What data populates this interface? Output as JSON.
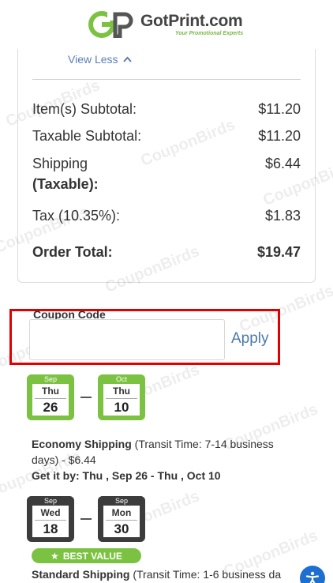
{
  "header": {
    "brand_name": "GotPrint.com",
    "tagline": "Your Promotional Experts"
  },
  "summary": {
    "view_less_label": "View Less",
    "rows": [
      {
        "label": "Item(s) Subtotal:",
        "value": "$11.20"
      },
      {
        "label": "Taxable Subtotal:",
        "value": "$11.20"
      },
      {
        "label": "Shipping",
        "label2": "(Taxable):",
        "value": "$6.44"
      },
      {
        "label": "Tax (10.35%):",
        "value": "$1.83"
      },
      {
        "label": "Order Total:",
        "value": "$19.47"
      }
    ]
  },
  "coupon": {
    "label": "Coupon Code",
    "value": "",
    "placeholder": "",
    "apply_label": "Apply"
  },
  "shipping_options": [
    {
      "from": {
        "month": "Sep",
        "dow": "Thu",
        "day": "26"
      },
      "to": {
        "month": "Oct",
        "dow": "Thu",
        "day": "10"
      },
      "name": "Economy Shipping",
      "details": " (Transit Time: 7-14 business days) - $6.44",
      "get_it_by": "Get it by: Thu , Sep 26 - Thu , Oct 10"
    },
    {
      "from": {
        "month": "Sep",
        "dow": "Wed",
        "day": "18"
      },
      "to": {
        "month": "Sep",
        "dow": "Mon",
        "day": "30"
      },
      "badge": "BEST VALUE",
      "name": "Standard Shipping",
      "details": " (Transit Time: 1-6 business da"
    }
  ],
  "watermark_text": "CouponBirds",
  "colors": {
    "green": "#7cc242",
    "dark": "#3c3c3c",
    "highlight_red": "#e00000",
    "link_blue": "#4a78b0",
    "accessibility_blue": "#1d6fd1"
  },
  "icons": [
    "gotprint-logo-icon",
    "chevron-up-icon",
    "calendar-icon",
    "star-icon",
    "accessibility-icon"
  ]
}
